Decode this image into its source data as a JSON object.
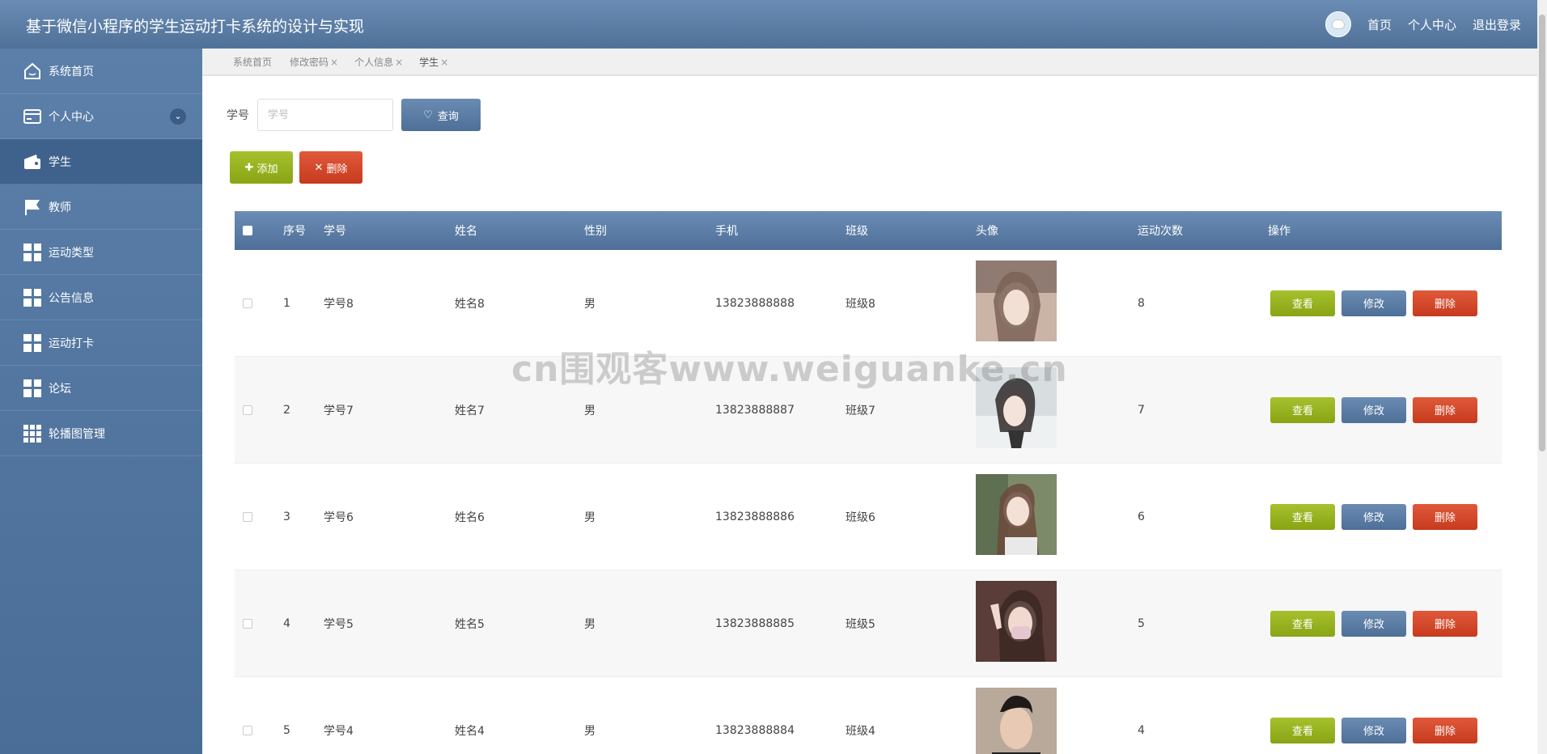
{
  "app": {
    "title": "基于微信小程序的学生运动打卡系统的设计与实现"
  },
  "topnav": {
    "home": "首页",
    "profile": "个人中心",
    "logout": "退出登录"
  },
  "sidebar": {
    "items": [
      {
        "label": "系统首页",
        "icon": "home-icon"
      },
      {
        "label": "个人中心",
        "icon": "card-icon"
      },
      {
        "label": "学生",
        "icon": "wallet-icon"
      },
      {
        "label": "教师",
        "icon": "flag-icon"
      },
      {
        "label": "运动类型",
        "icon": "grid-icon"
      },
      {
        "label": "公告信息",
        "icon": "grid-icon"
      },
      {
        "label": "运动打卡",
        "icon": "grid-icon"
      },
      {
        "label": "论坛",
        "icon": "grid-icon"
      },
      {
        "label": "轮播图管理",
        "icon": "grid9-icon"
      }
    ]
  },
  "tabs": [
    {
      "label": "系统首页",
      "close": ""
    },
    {
      "label": "修改密码",
      "close": "×"
    },
    {
      "label": "个人信息",
      "close": "×"
    },
    {
      "label": "学生",
      "close": "×"
    }
  ],
  "search": {
    "label": "学号",
    "placeholder": "学号",
    "button": "查询"
  },
  "actions": {
    "add": "添加",
    "delete": "删除"
  },
  "table": {
    "columns": [
      "序号",
      "学号",
      "姓名",
      "性别",
      "手机",
      "班级",
      "头像",
      "运动次数",
      "操作"
    ],
    "rows": [
      {
        "index": "1",
        "student_no": "学号8",
        "name": "姓名8",
        "gender": "男",
        "phone": "13823888888",
        "class": "班级8",
        "count": "8"
      },
      {
        "index": "2",
        "student_no": "学号7",
        "name": "姓名7",
        "gender": "男",
        "phone": "13823888887",
        "class": "班级7",
        "count": "7"
      },
      {
        "index": "3",
        "student_no": "学号6",
        "name": "姓名6",
        "gender": "男",
        "phone": "13823888886",
        "class": "班级6",
        "count": "6"
      },
      {
        "index": "4",
        "student_no": "学号5",
        "name": "姓名5",
        "gender": "男",
        "phone": "13823888885",
        "class": "班级5",
        "count": "5"
      },
      {
        "index": "5",
        "student_no": "学号4",
        "name": "姓名4",
        "gender": "男",
        "phone": "13823888884",
        "class": "班级4",
        "count": "4"
      }
    ],
    "row_actions": {
      "view": "查看",
      "edit": "修改",
      "delete": "删除"
    }
  },
  "watermark": "cn围观客www.weiguanke.cn",
  "colors": {
    "header": "#5b7fa9",
    "green": "#98b320",
    "blue": "#5b7ca5",
    "red": "#d84a2b"
  }
}
